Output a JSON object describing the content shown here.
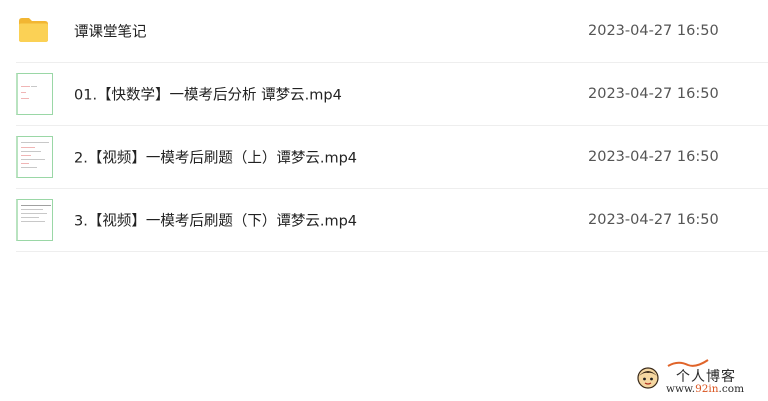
{
  "files": [
    {
      "type": "folder",
      "icon": "folder-icon",
      "name": "谭课堂笔记",
      "modified": "2023-04-27 16:50"
    },
    {
      "type": "video",
      "icon": "video-thumbnail",
      "name": "01.【快数学】一模考后分析 谭梦云.mp4",
      "modified": "2023-04-27 16:50"
    },
    {
      "type": "video",
      "icon": "video-thumbnail",
      "name": "2.【视频】一模考后刷题（上）谭梦云.mp4",
      "modified": "2023-04-27 16:50"
    },
    {
      "type": "video",
      "icon": "video-thumbnail",
      "name": "3.【视频】一模考后刷题（下）谭梦云.mp4",
      "modified": "2023-04-27 16:50"
    }
  ],
  "watermark": {
    "title": "个人博客",
    "url_prefix": "www.",
    "url_accent": "92in",
    "url_suffix": ".com"
  },
  "colors": {
    "folder": "#f7c948",
    "date_text": "#555555",
    "divider": "#eeeeee",
    "thumb_border": "#9ad7a6"
  }
}
